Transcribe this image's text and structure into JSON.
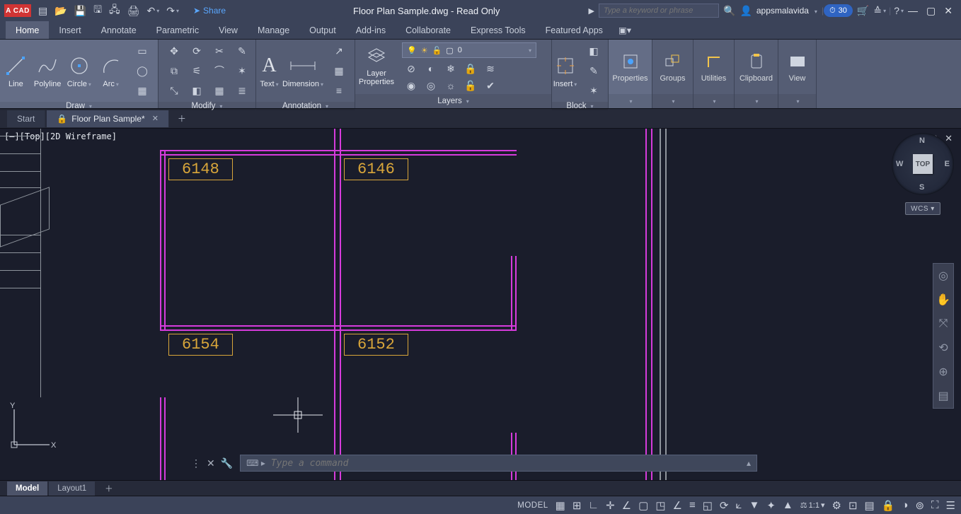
{
  "app_badge": "A CAD",
  "title": "Floor Plan Sample.dwg - Read Only",
  "share_label": "Share",
  "search_placeholder": "Type a keyword or phrase",
  "username": "appsmalavida",
  "trial_badge": "30",
  "ribbon_tabs": [
    "Home",
    "Insert",
    "Annotate",
    "Parametric",
    "View",
    "Manage",
    "Output",
    "Add-ins",
    "Collaborate",
    "Express Tools",
    "Featured Apps"
  ],
  "draw": {
    "line": "Line",
    "polyline": "Polyline",
    "circle": "Circle",
    "arc": "Arc",
    "cap": "Draw"
  },
  "modify": {
    "cap": "Modify"
  },
  "annotation": {
    "text": "Text",
    "dim": "Dimension",
    "cap": "Annotation"
  },
  "layers": {
    "props": "Layer Properties",
    "current": "0",
    "cap": "Layers"
  },
  "block": {
    "insert": "Insert",
    "cap": "Block"
  },
  "panels": {
    "properties": "Properties",
    "groups": "Groups",
    "utilities": "Utilities",
    "clipboard": "Clipboard",
    "view": "View"
  },
  "doc_tabs": {
    "start": "Start",
    "file": "Floor Plan Sample*"
  },
  "viewport_label": "[–][Top][2D Wireframe]",
  "dimensions": {
    "a": "6148",
    "b": "6146",
    "c": "6154",
    "d": "6152"
  },
  "viewcube": {
    "face": "TOP",
    "n": "N",
    "s": "S",
    "e": "E",
    "w": "W",
    "wcs": "WCS"
  },
  "command_placeholder": "Type a command",
  "layout_tabs": {
    "model": "Model",
    "layout1": "Layout1"
  },
  "status": {
    "model": "MODEL",
    "scale": "1:1"
  }
}
